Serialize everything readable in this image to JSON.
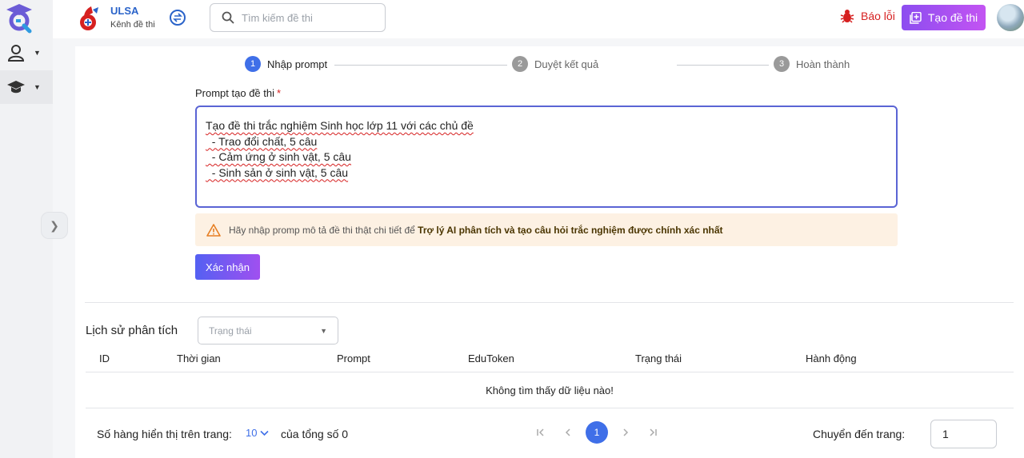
{
  "header": {
    "brand_title": "ULSA",
    "brand_subtitle": "Kênh đề thi",
    "search_placeholder": "Tìm kiếm đề thi",
    "report_label": "Báo lỗi",
    "create_label": "Tạo đề thi"
  },
  "stepper": {
    "steps": [
      {
        "num": "1",
        "label": "Nhập prompt"
      },
      {
        "num": "2",
        "label": "Duyệt kết quả"
      },
      {
        "num": "3",
        "label": "Hoàn thành"
      }
    ]
  },
  "prompt": {
    "label": "Prompt tạo đề thi",
    "required_mark": "*",
    "lines": [
      "Tạo đề thi trắc nghiệm Sinh học lớp 11 với các chủ đề",
      "  - Trao đổi chất, 5 câu",
      "  - Cảm ứng ở sinh vật, 5 câu",
      "  - Sinh sản ở sinh vật, 5 câu"
    ]
  },
  "warning": {
    "text": "Hãy nhập promp mô tả đề thi thật chi tiết để",
    "bold": "Trợ lý AI phân tích và tạo câu hỏi trắc nghiệm được chính xác nhất"
  },
  "confirm_label": "Xác nhận",
  "history": {
    "title": "Lịch sử phân tích",
    "status_placeholder": "Trạng thái",
    "columns": [
      "ID",
      "Thời gian",
      "Prompt",
      "EduToken",
      "Trạng thái",
      "Hành động"
    ],
    "empty_message": "Không tìm thấy dữ liệu nào!"
  },
  "pagination": {
    "rows_label": "Số hàng hiển thị trên trang:",
    "rows_value": "10",
    "total_label": "của tổng số 0",
    "current_page": "1",
    "goto_label": "Chuyển đến trang:",
    "goto_value": "1"
  },
  "colors": {
    "primary": "#3f6fe8",
    "create_button": "#a450f2",
    "report": "#d62020",
    "warning_bg": "#fdf1e3"
  }
}
